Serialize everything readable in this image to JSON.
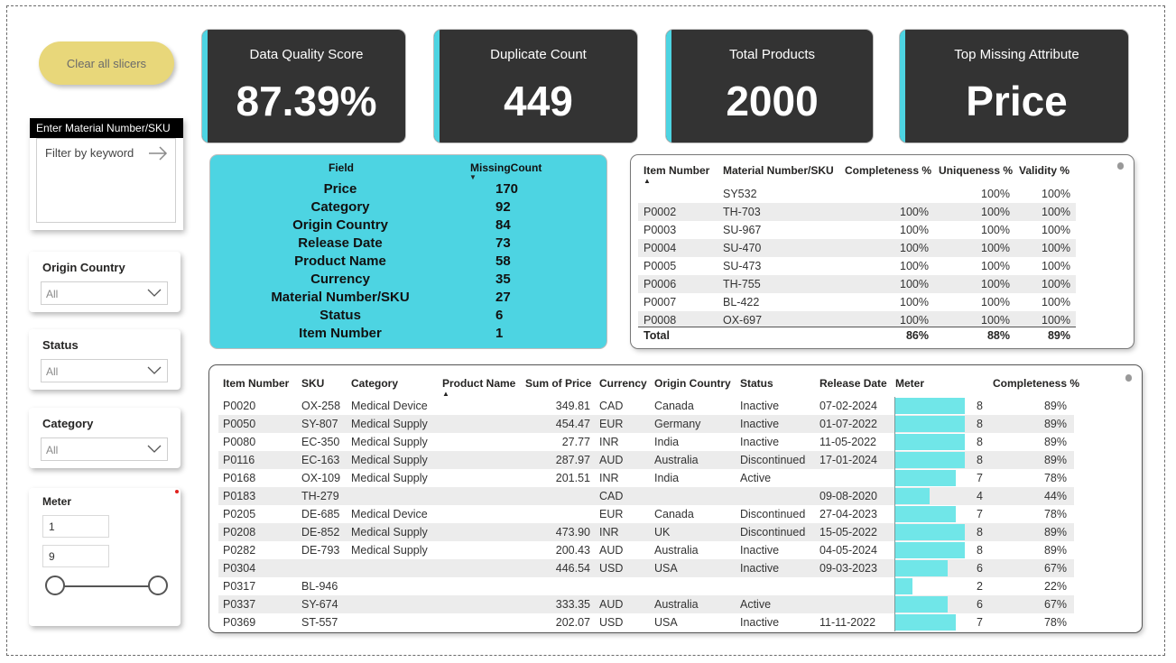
{
  "clear_button": {
    "label": "Clear all slicers"
  },
  "kpis": [
    {
      "title": "Data Quality Score",
      "value": "87.39%"
    },
    {
      "title": "Duplicate Count",
      "value": "449"
    },
    {
      "title": "Total Products",
      "value": "2000"
    },
    {
      "title": "Top Missing Attribute",
      "value": "Price"
    }
  ],
  "colors": {
    "accent": "#4dd4e2",
    "kpi_bg": "#333333",
    "button": "#e8d77a",
    "meter_bar": "#70e6e8"
  },
  "search_slicer": {
    "header": "Enter Material Number/SKU",
    "placeholder": "Filter by keyword"
  },
  "slicers": {
    "origin_country": {
      "title": "Origin Country",
      "value": "All"
    },
    "status": {
      "title": "Status",
      "value": "All"
    },
    "category": {
      "title": "Category",
      "value": "All"
    }
  },
  "meter_slicer": {
    "title": "Meter",
    "min": "1",
    "max": "9"
  },
  "missing_table": {
    "headers": {
      "field": "Field",
      "count": "MissingCount"
    },
    "rows": [
      {
        "field": "Price",
        "count": "170"
      },
      {
        "field": "Category",
        "count": "92"
      },
      {
        "field": "Origin Country",
        "count": "84"
      },
      {
        "field": "Release Date",
        "count": "73"
      },
      {
        "field": "Product Name",
        "count": "58"
      },
      {
        "field": "Currency",
        "count": "35"
      },
      {
        "field": "Material Number/SKU",
        "count": "27"
      },
      {
        "field": "Status",
        "count": "6"
      },
      {
        "field": "Item Number",
        "count": "1"
      }
    ]
  },
  "quality_table": {
    "headers": {
      "item": "Item Number",
      "sku": "Material Number/SKU",
      "completeness": "Completeness %",
      "uniqueness": "Uniqueness %",
      "validity": "Validity %"
    },
    "rows": [
      {
        "item": "",
        "sku": "SY532",
        "completeness": "",
        "uniqueness": "100%",
        "validity": "100%"
      },
      {
        "item": "P0002",
        "sku": "TH-703",
        "completeness": "100%",
        "uniqueness": "100%",
        "validity": "100%"
      },
      {
        "item": "P0003",
        "sku": "SU-967",
        "completeness": "100%",
        "uniqueness": "100%",
        "validity": "100%"
      },
      {
        "item": "P0004",
        "sku": "SU-470",
        "completeness": "100%",
        "uniqueness": "100%",
        "validity": "100%"
      },
      {
        "item": "P0005",
        "sku": "SU-473",
        "completeness": "100%",
        "uniqueness": "100%",
        "validity": "100%"
      },
      {
        "item": "P0006",
        "sku": "TH-755",
        "completeness": "100%",
        "uniqueness": "100%",
        "validity": "100%"
      },
      {
        "item": "P0007",
        "sku": "BL-422",
        "completeness": "100%",
        "uniqueness": "100%",
        "validity": "100%"
      },
      {
        "item": "P0008",
        "sku": "OX-697",
        "completeness": "100%",
        "uniqueness": "100%",
        "validity": "100%"
      }
    ],
    "total": {
      "label": "Total",
      "completeness": "86%",
      "uniqueness": "88%",
      "validity": "89%"
    }
  },
  "detail_table": {
    "headers": {
      "item": "Item Number",
      "sku": "SKU",
      "category": "Category",
      "product": "Product Name",
      "price": "Sum of Price",
      "currency": "Currency",
      "country": "Origin Country",
      "status": "Status",
      "release": "Release Date",
      "meter": "Meter",
      "completeness": "Completeness %"
    },
    "meter_max": 9,
    "rows": [
      {
        "item": "P0020",
        "sku": "OX-258",
        "category": "Medical Device",
        "product": "",
        "price": "349.81",
        "currency": "CAD",
        "country": "Canada",
        "status": "Inactive",
        "release": "07-02-2024",
        "meter": 8,
        "meter_label": "8",
        "completeness": "89%"
      },
      {
        "item": "P0050",
        "sku": "SY-807",
        "category": "Medical Supply",
        "product": "",
        "price": "454.47",
        "currency": "EUR",
        "country": "Germany",
        "status": "Inactive",
        "release": "01-07-2022",
        "meter": 8,
        "meter_label": "8",
        "completeness": "89%"
      },
      {
        "item": "P0080",
        "sku": "EC-350",
        "category": "Medical Supply",
        "product": "",
        "price": "27.77",
        "currency": "INR",
        "country": "India",
        "status": "Inactive",
        "release": "11-05-2022",
        "meter": 8,
        "meter_label": "8",
        "completeness": "89%"
      },
      {
        "item": "P0116",
        "sku": "EC-163",
        "category": "Medical Supply",
        "product": "",
        "price": "287.97",
        "currency": "AUD",
        "country": "Australia",
        "status": "Discontinued",
        "release": "17-01-2024",
        "meter": 8,
        "meter_label": "8",
        "completeness": "89%"
      },
      {
        "item": "P0168",
        "sku": "OX-109",
        "category": "Medical Supply",
        "product": "",
        "price": "201.51",
        "currency": "INR",
        "country": "India",
        "status": "Active",
        "release": "",
        "meter": 7,
        "meter_label": "7",
        "completeness": "78%"
      },
      {
        "item": "P0183",
        "sku": "TH-279",
        "category": "",
        "product": "",
        "price": "",
        "currency": "CAD",
        "country": "",
        "status": "",
        "release": "09-08-2020",
        "meter": 4,
        "meter_label": "4",
        "completeness": "44%"
      },
      {
        "item": "P0205",
        "sku": "DE-685",
        "category": "Medical Device",
        "product": "",
        "price": "",
        "currency": "EUR",
        "country": "Canada",
        "status": "Discontinued",
        "release": "27-04-2023",
        "meter": 7,
        "meter_label": "7",
        "completeness": "78%"
      },
      {
        "item": "P0208",
        "sku": "DE-852",
        "category": "Medical Supply",
        "product": "",
        "price": "473.90",
        "currency": "INR",
        "country": "UK",
        "status": "Discontinued",
        "release": "15-05-2022",
        "meter": 8,
        "meter_label": "8",
        "completeness": "89%"
      },
      {
        "item": "P0282",
        "sku": "DE-793",
        "category": "Medical Supply",
        "product": "",
        "price": "200.43",
        "currency": "AUD",
        "country": "Australia",
        "status": "Inactive",
        "release": "04-05-2024",
        "meter": 8,
        "meter_label": "8",
        "completeness": "89%"
      },
      {
        "item": "P0304",
        "sku": "",
        "category": "",
        "product": "",
        "price": "446.54",
        "currency": "USD",
        "country": "USA",
        "status": "Inactive",
        "release": "09-03-2023",
        "meter": 6,
        "meter_label": "6",
        "completeness": "67%"
      },
      {
        "item": "P0317",
        "sku": "BL-946",
        "category": "",
        "product": "",
        "price": "",
        "currency": "",
        "country": "",
        "status": "",
        "release": "",
        "meter": 2,
        "meter_label": "2",
        "completeness": "22%"
      },
      {
        "item": "P0337",
        "sku": "SY-674",
        "category": "",
        "product": "",
        "price": "333.35",
        "currency": "AUD",
        "country": "Australia",
        "status": "Active",
        "release": "",
        "meter": 6,
        "meter_label": "6",
        "completeness": "67%"
      },
      {
        "item": "P0369",
        "sku": "ST-557",
        "category": "",
        "product": "",
        "price": "202.07",
        "currency": "USD",
        "country": "USA",
        "status": "Inactive",
        "release": "11-11-2022",
        "meter": 7,
        "meter_label": "7",
        "completeness": "78%"
      }
    ]
  }
}
